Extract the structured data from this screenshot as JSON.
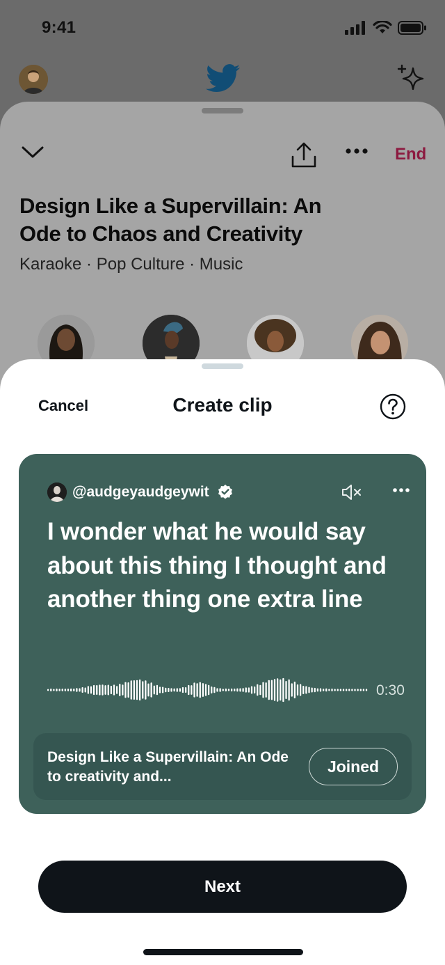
{
  "status_bar": {
    "time": "9:41"
  },
  "space": {
    "end_label": "End",
    "title": "Design Like a Supervillain: An Ode to Chaos and Creativity",
    "tags": "Karaoke · Pop Culture · Music"
  },
  "clip_sheet": {
    "cancel_label": "Cancel",
    "title": "Create clip"
  },
  "clip_card": {
    "handle": "@audgeyaudgeywit",
    "quote": "I wonder what he would say about this thing I thought and another thing one extra line",
    "duration": "0:30",
    "space_title": "Design Like a Supervillain: An Ode to creativity and...",
    "joined_label": "Joined",
    "background_color": "#3e615a"
  },
  "next_label": "Next",
  "colors": {
    "end_accent": "#8c1a40",
    "primary_button": "#0f1419"
  }
}
